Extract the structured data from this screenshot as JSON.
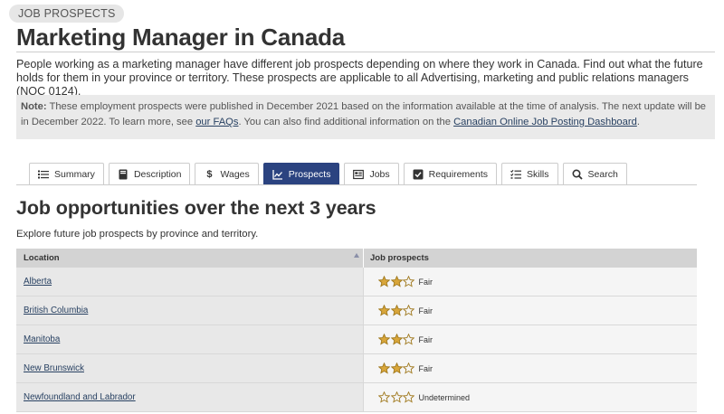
{
  "header": {
    "badge": "JOB PROSPECTS",
    "title": "Marketing Manager in Canada"
  },
  "intro": "People working as a marketing manager have different job prospects depending on where they work in Canada. Find out what the future holds for them in your province or territory. These prospects are applicable to all Advertising, marketing and public relations managers (NOC 0124).",
  "note": {
    "label": "Note:",
    "text_before": " These employment prospects were published in December 2021 based on the information available at the time of analysis. The next update will be in December 2022. To learn more, see ",
    "faq_link": "our FAQs",
    "text_middle": ". You can also find additional information on the ",
    "dashboard_link": "Canadian Online Job Posting Dashboard",
    "text_after": "."
  },
  "tabs": [
    {
      "label": "Summary",
      "icon": "list-icon",
      "active": false
    },
    {
      "label": "Description",
      "icon": "book-icon",
      "active": false
    },
    {
      "label": "Wages",
      "icon": "dollar-icon",
      "active": false
    },
    {
      "label": "Prospects",
      "icon": "chart-line-icon",
      "active": true
    },
    {
      "label": "Jobs",
      "icon": "newspaper-icon",
      "active": false
    },
    {
      "label": "Requirements",
      "icon": "checkbox-icon",
      "active": false
    },
    {
      "label": "Skills",
      "icon": "checklist-icon",
      "active": false
    },
    {
      "label": "Search",
      "icon": "search-icon",
      "active": false
    }
  ],
  "section": {
    "heading": "Job opportunities over the next 3 years",
    "subheading": "Explore future job prospects by province and territory."
  },
  "table": {
    "columns": [
      "Location",
      "Job prospects"
    ],
    "rows": [
      {
        "location": "Alberta",
        "stars_filled": 2,
        "stars_total": 3,
        "prospect": "Fair"
      },
      {
        "location": "British Columbia",
        "stars_filled": 2,
        "stars_total": 3,
        "prospect": "Fair"
      },
      {
        "location": "Manitoba",
        "stars_filled": 2,
        "stars_total": 3,
        "prospect": "Fair"
      },
      {
        "location": "New Brunswick",
        "stars_filled": 2,
        "stars_total": 3,
        "prospect": "Fair"
      },
      {
        "location": "Newfoundland and Labrador",
        "stars_filled": 0,
        "stars_total": 3,
        "prospect": "Undetermined"
      }
    ]
  },
  "colors": {
    "accent": "#2b4380",
    "link": "#284162",
    "star_fill": "#d9a63a",
    "star_outline": "#a0791e"
  }
}
